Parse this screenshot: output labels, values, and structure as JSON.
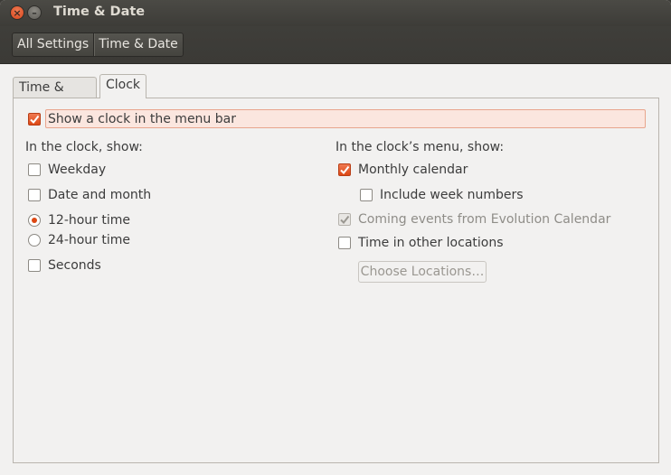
{
  "window": {
    "title": "Time & Date",
    "close_glyph": "×",
    "minimize_glyph": "–"
  },
  "breadcrumb": {
    "items": [
      {
        "label": "All Settings"
      },
      {
        "label": "Time & Date"
      }
    ]
  },
  "tabs": [
    {
      "label": "Time & Date",
      "active": false
    },
    {
      "label": "Clock",
      "active": true
    }
  ],
  "clock_tab": {
    "show_clock": {
      "label": "Show a clock in the menu bar",
      "checked": true
    },
    "in_clock": {
      "heading": "In the clock, show:",
      "weekday": {
        "label": "Weekday",
        "checked": false
      },
      "date_month": {
        "label": "Date and month",
        "checked": false
      },
      "hour12": {
        "label": "12-hour time",
        "selected": true
      },
      "hour24": {
        "label": "24-hour time",
        "selected": false
      },
      "seconds": {
        "label": "Seconds",
        "checked": false
      }
    },
    "in_menu": {
      "heading": "In the clock’s menu, show:",
      "monthly_calendar": {
        "label": "Monthly calendar",
        "checked": true
      },
      "week_numbers": {
        "label": "Include week numbers",
        "checked": false
      },
      "coming_events": {
        "label": "Coming events from Evolution Calendar",
        "checked": true,
        "disabled": true
      },
      "other_locations": {
        "label": "Time in other locations",
        "checked": false
      },
      "choose_locations": {
        "label": "Choose Locations…",
        "disabled": true
      }
    }
  },
  "colors": {
    "accent": "#dd4814",
    "titlebar": "#3c3b37",
    "window_bg": "#f2f1f0"
  }
}
